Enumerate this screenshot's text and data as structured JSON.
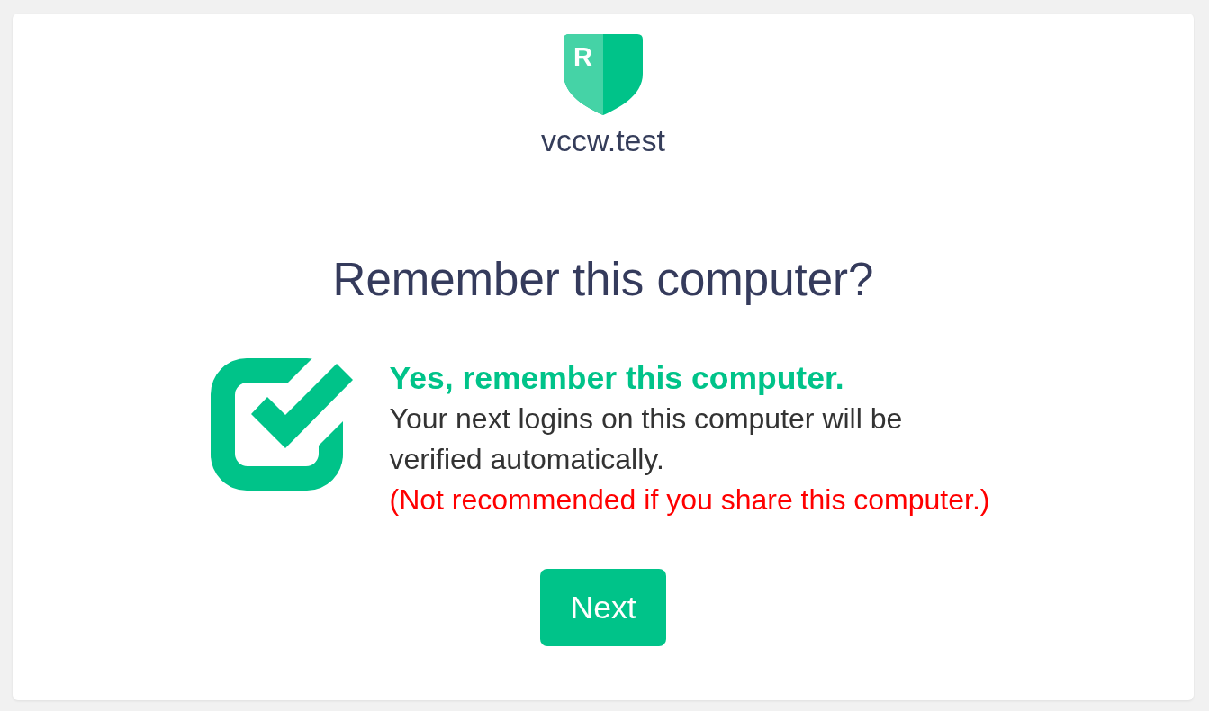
{
  "logo": {
    "letter": "R"
  },
  "site": "vccw.test",
  "heading": "Remember this computer?",
  "option": {
    "checked": true,
    "title": "Yes, remember this computer.",
    "description": "Your next logins on this computer will be verified automatically.",
    "warning": "(Not recommended if you share this computer.)"
  },
  "buttons": [
    {
      "label": "Next"
    }
  ]
}
